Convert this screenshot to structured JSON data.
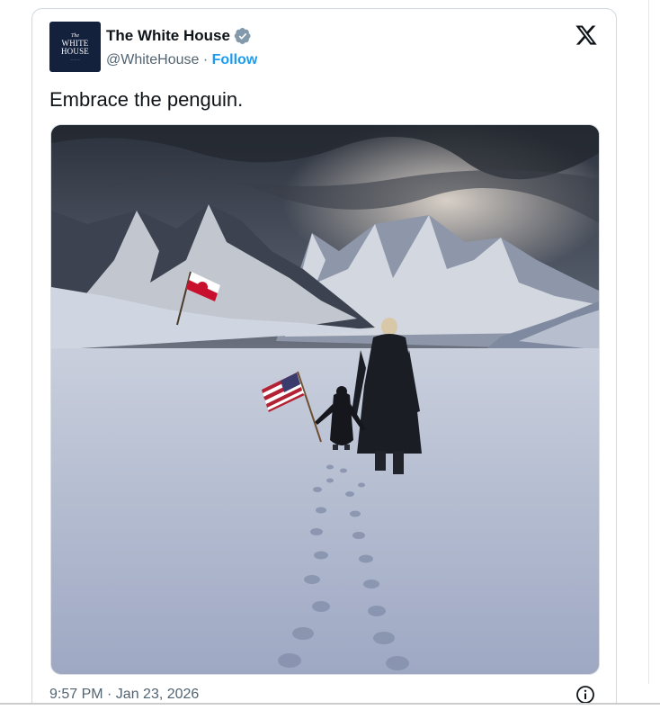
{
  "tweet": {
    "author": {
      "name": "The White House",
      "handle": "@WhiteHouse",
      "separator": " · ",
      "follow_label": "Follow",
      "avatar_text": {
        "line0": "The",
        "line1": "WHITE",
        "line2": "HOUSE"
      }
    },
    "text": "Embrace the penguin.",
    "timestamp": "9:57 PM · Jan 23, 2026",
    "colors": {
      "verified": "#829aab",
      "link": "#1d9bf0",
      "avatar_bg": "#14213d"
    },
    "icons": {
      "verified": "verified-badge-icon",
      "platform": "x-logo-icon",
      "info": "info-icon"
    }
  }
}
